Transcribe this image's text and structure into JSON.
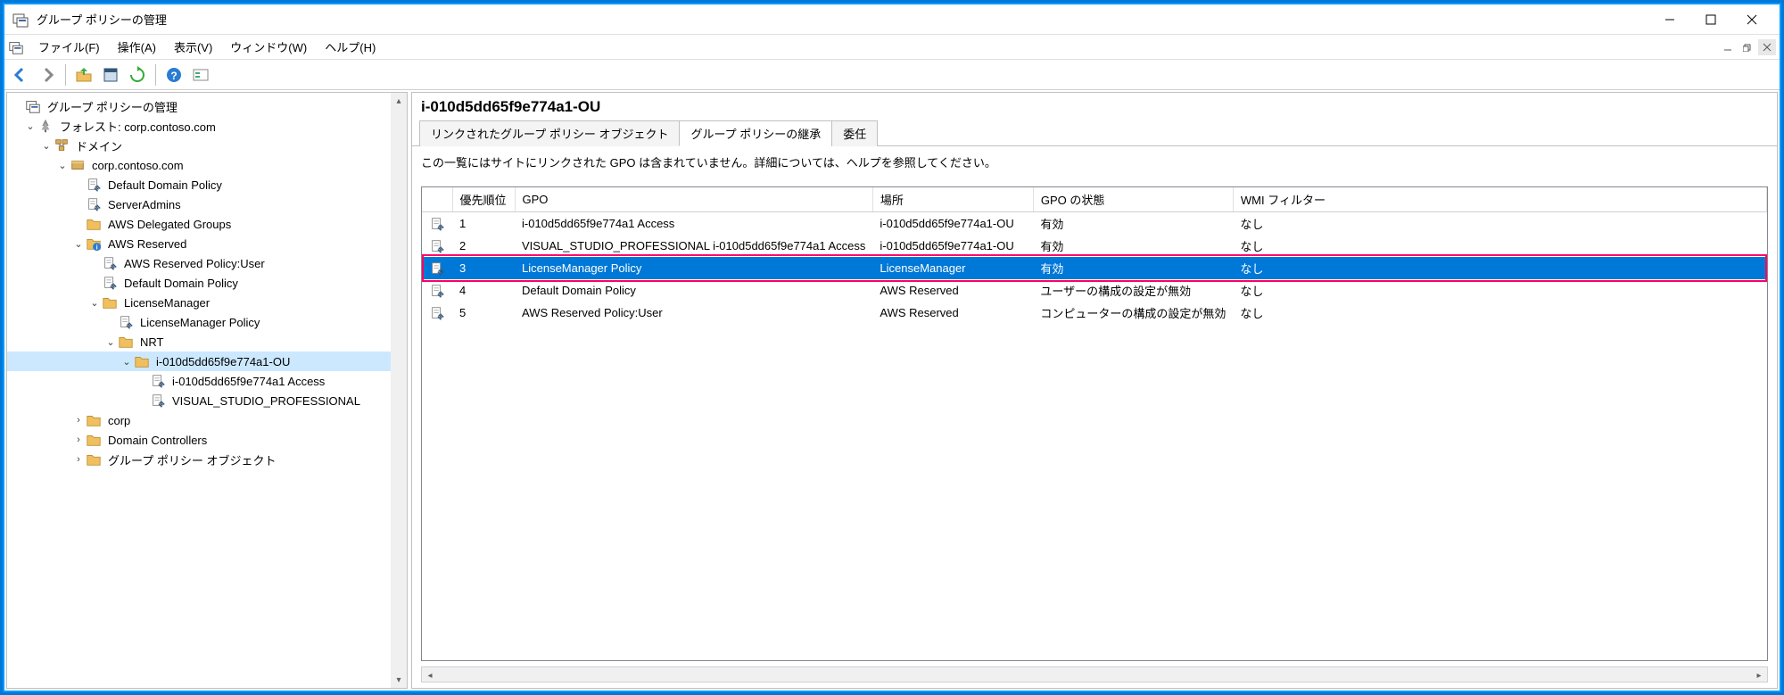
{
  "window": {
    "title": "グループ ポリシーの管理"
  },
  "menu": {
    "file": "ファイル(F)",
    "action": "操作(A)",
    "view": "表示(V)",
    "window": "ウィンドウ(W)",
    "help": "ヘルプ(H)"
  },
  "tree": {
    "root": "グループ ポリシーの管理",
    "forest": "フォレスト: corp.contoso.com",
    "domains": "ドメイン",
    "domain": "corp.contoso.com",
    "default_policy": "Default Domain Policy",
    "server_admins": "ServerAdmins",
    "aws_delegated": "AWS Delegated Groups",
    "aws_reserved": "AWS Reserved",
    "aws_reserved_user": "AWS Reserved Policy:User",
    "default_policy2": "Default Domain Policy",
    "license_manager": "LicenseManager",
    "license_manager_policy": "LicenseManager Policy",
    "nrt": "NRT",
    "ou_selected": "i-010d5dd65f9e774a1-OU",
    "access": "i-010d5dd65f9e774a1 Access",
    "vs_professional": "VISUAL_STUDIO_PROFESSIONAL",
    "corp": "corp",
    "domain_controllers": "Domain Controllers",
    "gpo_objects": "グループ ポリシー オブジェクト"
  },
  "detail": {
    "title": "i-010d5dd65f9e774a1-OU",
    "tabs": {
      "linked": "リンクされたグループ ポリシー オブジェクト",
      "inheritance": "グループ ポリシーの継承",
      "delegation": "委任"
    },
    "info": "この一覧にはサイトにリンクされた GPO は含まれていません。詳細については、ヘルプを参照してください。",
    "columns": {
      "priority": "優先順位",
      "gpo": "GPO",
      "location": "場所",
      "status": "GPO の状態",
      "wmi": "WMI フィルター"
    },
    "rows": [
      {
        "priority": "1",
        "gpo": "i-010d5dd65f9e774a1 Access",
        "location": "i-010d5dd65f9e774a1-OU",
        "status": "有効",
        "wmi": "なし",
        "selected": false
      },
      {
        "priority": "2",
        "gpo": "VISUAL_STUDIO_PROFESSIONAL i-010d5dd65f9e774a1 Access",
        "location": "i-010d5dd65f9e774a1-OU",
        "status": "有効",
        "wmi": "なし",
        "selected": false
      },
      {
        "priority": "3",
        "gpo": "LicenseManager Policy",
        "location": "LicenseManager",
        "status": "有効",
        "wmi": "なし",
        "selected": true
      },
      {
        "priority": "4",
        "gpo": "Default Domain Policy",
        "location": "AWS Reserved",
        "status": "ユーザーの構成の設定が無効",
        "wmi": "なし",
        "selected": false
      },
      {
        "priority": "5",
        "gpo": "AWS Reserved Policy:User",
        "location": "AWS Reserved",
        "status": "コンピューターの構成の設定が無効",
        "wmi": "なし",
        "selected": false
      }
    ]
  }
}
